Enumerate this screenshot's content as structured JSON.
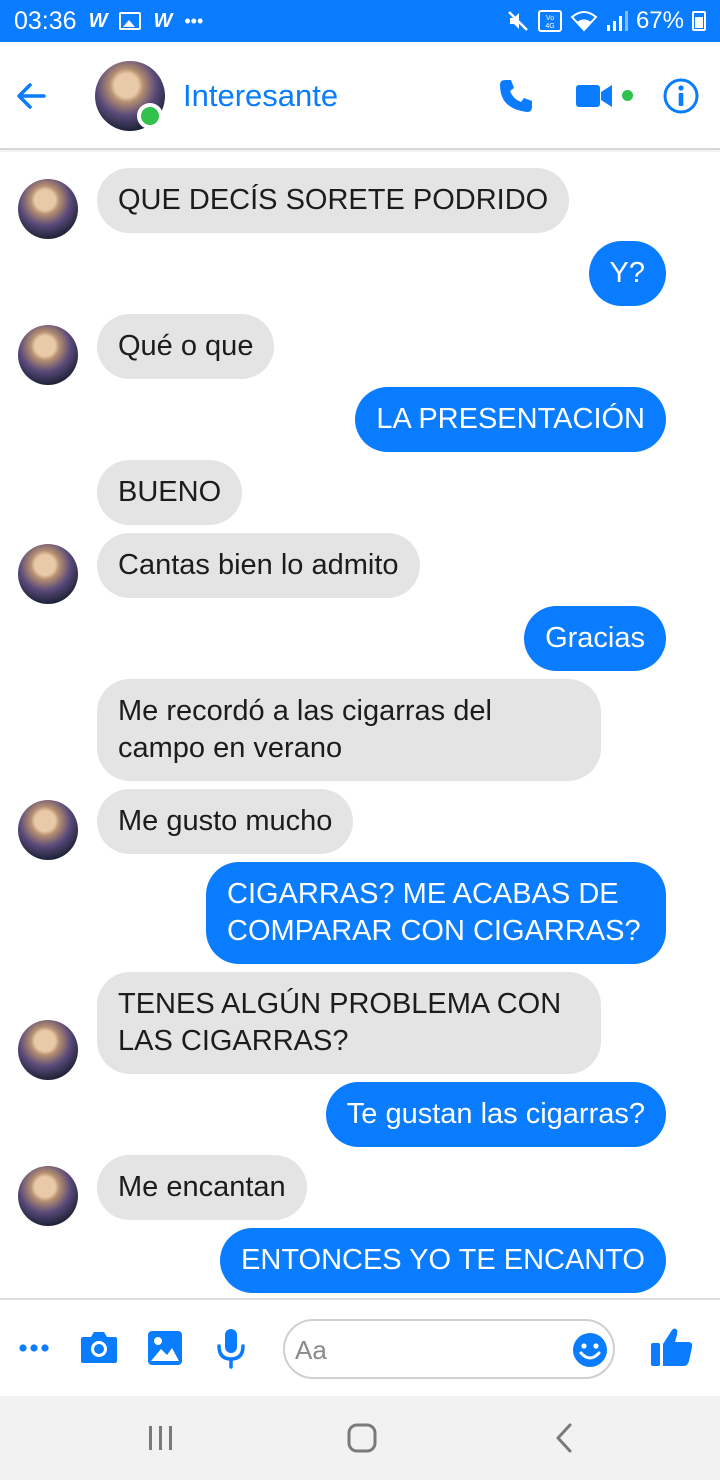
{
  "status_bar": {
    "time": "03:36",
    "battery": "67%",
    "icons": [
      "w-app-icon",
      "gallery-icon",
      "w-app-icon",
      "more-icon",
      "mute-icon",
      "volte-icon",
      "wifi-icon",
      "signal-icon",
      "battery-icon"
    ]
  },
  "header": {
    "title": "Interesante",
    "accent_color": "#0a7cff",
    "online_color": "#31c24d"
  },
  "messages": [
    {
      "side": "in",
      "lines": [
        "QUE DECÍS SORETE PODRIDO"
      ]
    },
    {
      "side": "out",
      "lines": [
        "Y?"
      ]
    },
    {
      "side": "in",
      "lines": [
        "Qué o que"
      ]
    },
    {
      "side": "out",
      "lines": [
        "LA PRESENTACIÓN"
      ]
    },
    {
      "side": "in",
      "lines": [
        "BUENO"
      ]
    },
    {
      "side": "in",
      "lines": [
        "Cantas bien lo admito"
      ]
    },
    {
      "side": "out",
      "lines": [
        "Gracias"
      ]
    },
    {
      "side": "in",
      "lines": [
        "Me recordó a las cigarras del",
        "campo en verano"
      ]
    },
    {
      "side": "in",
      "lines": [
        "Me gusto mucho"
      ]
    },
    {
      "side": "out",
      "lines": [
        "CIGARRAS? ME ACABAS DE",
        "COMPARAR CON CIGARRAS?"
      ]
    },
    {
      "side": "in",
      "lines": [
        "TENES ALGÚN PROBLEMA CON",
        "LAS CIGARRAS?"
      ]
    },
    {
      "side": "out",
      "lines": [
        "Te gustan las cigarras?"
      ]
    },
    {
      "side": "in",
      "lines": [
        "Me encantan"
      ]
    },
    {
      "side": "out",
      "lines": [
        "ENTONCES YO TE ENCANTO"
      ]
    }
  ],
  "composer": {
    "placeholder": "Aa",
    "value": ""
  },
  "colors": {
    "incoming_bubble": "#e4e4e4",
    "outgoing_bubble": "#0a7cff"
  }
}
